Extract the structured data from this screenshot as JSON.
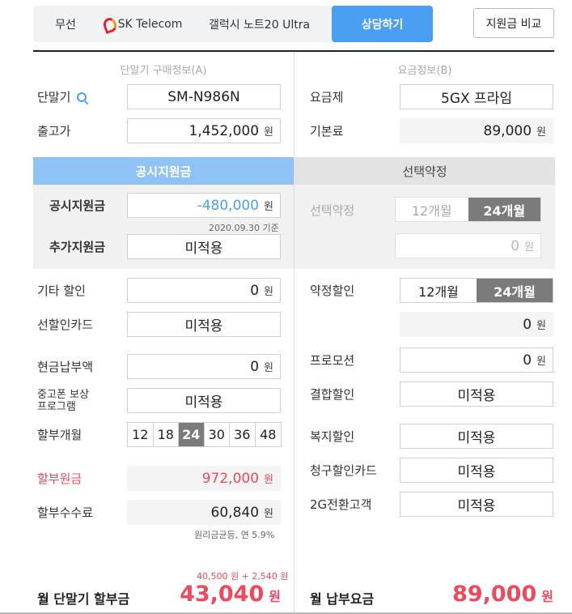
{
  "filter": {
    "wireless": "무선",
    "carrier": "SK Telecom",
    "model": "갤럭시 노트20 Ultra",
    "consult": "상담하기"
  },
  "compare_label": "지원금 비교",
  "left": {
    "header": "단말기 구매정보(A)",
    "device_label": "단말기",
    "device_value": "SM-N986N",
    "price_label": "출고가",
    "price_value": "1,452,000",
    "subsidy_band": "공시지원금",
    "subsidy_label": "공시지원금",
    "subsidy_value": "-480,000",
    "subsidy_date": "2020.09.30 기준",
    "extra_label": "추가지원금",
    "extra_value": "미적용",
    "other_label": "기타 할인",
    "other_value": "0",
    "card_label": "선할인카드",
    "card_value": "미적용",
    "cash_label": "현금납부액",
    "cash_value": "0",
    "used_label_1": "중고폰 보상",
    "used_label_2": "프로그램",
    "used_value": "미적용",
    "months_label": "할부개월",
    "months": [
      "12",
      "18",
      "24",
      "30",
      "36",
      "48"
    ],
    "principal_label": "할부원금",
    "principal_value": "972,000",
    "fee_label": "할부수수료",
    "fee_value": "60,840",
    "fee_note": "원리금균등, 연 5.9%",
    "breakdown": "40,500 원 + 2,540 원",
    "monthly_label": "월 단말기 할부금",
    "monthly_value": "43,040"
  },
  "right": {
    "header": "요금정보(B)",
    "plan_label": "요금제",
    "plan_value": "5GX 프라임",
    "base_label": "기본료",
    "base_value": "89,000",
    "select_band": "선택약정",
    "select_label": "선택약정",
    "select_opt_12": "12개월",
    "select_opt_24": "24개월",
    "select_value": "0",
    "contract_label": "약정할인",
    "contract_opt_12": "12개월",
    "contract_opt_24": "24개월",
    "contract_value": "0",
    "promo_label": "프로모션",
    "promo_value": "0",
    "bundle_label": "결합할인",
    "bundle_value": "미적용",
    "welfare_label": "복지할인",
    "welfare_value": "미적용",
    "billcard_label": "청구할인카드",
    "billcard_value": "미적용",
    "switch_label": "2G전환고객",
    "switch_value": "미적용",
    "monthly_label": "월 납부요금",
    "monthly_value": "89,000"
  },
  "won": "원",
  "colors": {
    "accent": "#4a9ff5",
    "accent_light": "#8fc3f6",
    "highlight": "#f2485b",
    "selected": "#7b7b7b"
  },
  "icons": {
    "device_search": "search-icon",
    "carrier_logo": "sk-logo-icon"
  }
}
